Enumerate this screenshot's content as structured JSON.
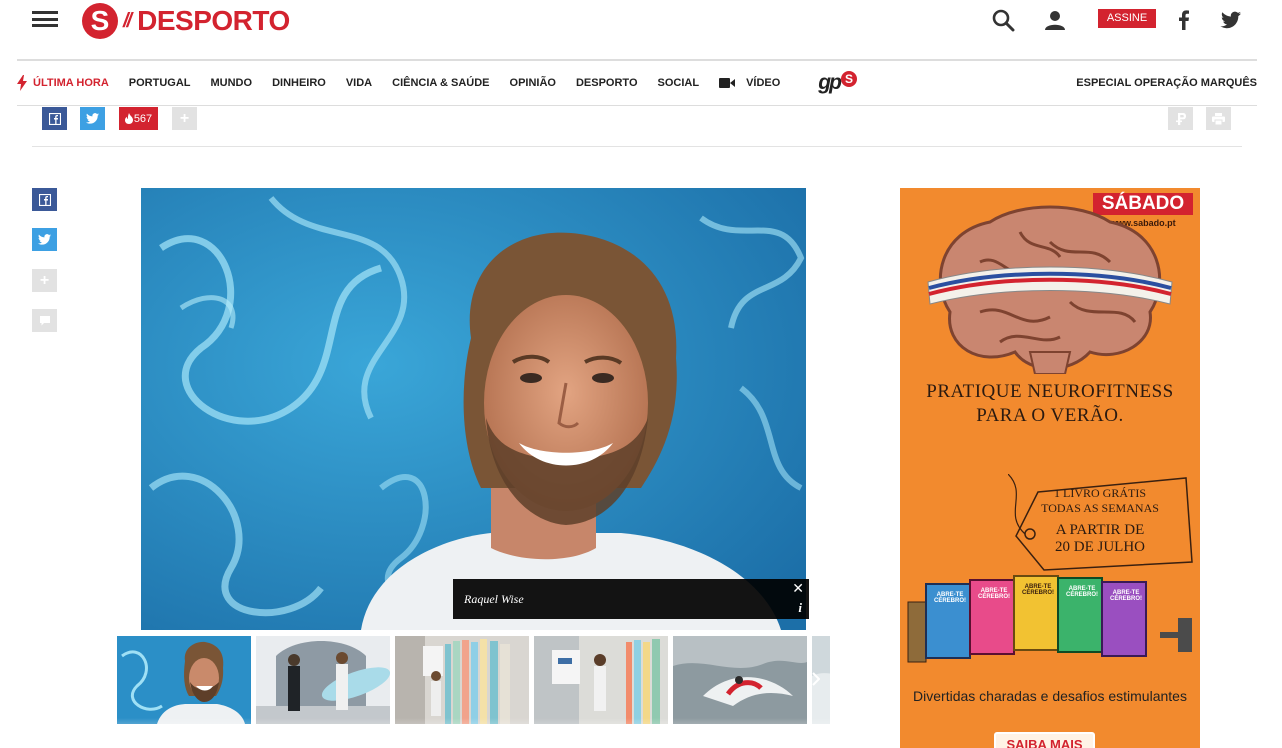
{
  "header": {
    "logo_letter": "S",
    "logo_slash": "//",
    "section": "DESPORTO",
    "subscribe_label": "ASSINE"
  },
  "nav": {
    "items": [
      {
        "label": "ÚLTIMA HORA"
      },
      {
        "label": "PORTUGAL"
      },
      {
        "label": "MUNDO"
      },
      {
        "label": "DINHEIRO"
      },
      {
        "label": "VIDA"
      },
      {
        "label": "CIÊNCIA & SAÚDE"
      },
      {
        "label": "OPINIÃO"
      },
      {
        "label": "DESPORTO"
      },
      {
        "label": "SOCIAL"
      },
      {
        "label": "VÍDEO"
      }
    ],
    "gps_text": "gp",
    "gps_badge": "S",
    "right_label": "ESPECIAL OPERAÇÃO MARQUÊS"
  },
  "share": {
    "count": "567",
    "plus": "+"
  },
  "gallery": {
    "caption": "Raquel Wise",
    "close": "✕",
    "info": "i"
  },
  "ad": {
    "brand": "SÁBADO",
    "url": "www.sabado.pt",
    "headline_1": "PRATIQUE NEUROFITNESS",
    "headline_2": "PARA O VERÃO.",
    "tag_1": "1 LIVRO GRÁTIS",
    "tag_2": "TODAS AS SEMANAS",
    "tag_3": "A PARTIR DE",
    "tag_4": "20 DE JULHO",
    "footer": "Divertidas charadas e desafios estimulantes",
    "button": "SAIBA MAIS",
    "book_title": "ABRE-TE CÉREBRO!"
  },
  "colors": {
    "brand_red": "#d3232f",
    "facebook": "#3b5998",
    "twitter": "#3da0e3",
    "ad_orange": "#f28a2e"
  }
}
